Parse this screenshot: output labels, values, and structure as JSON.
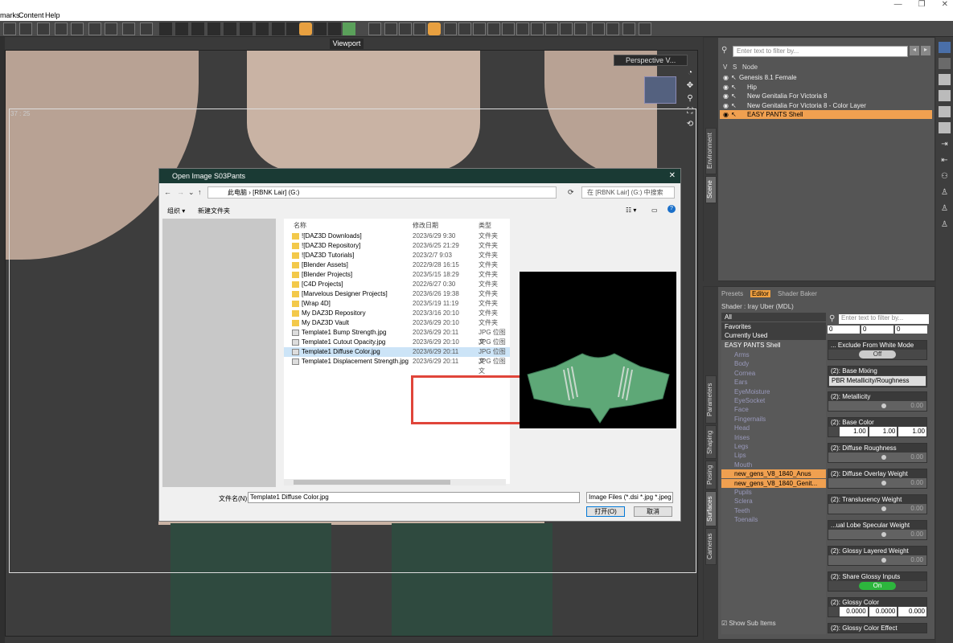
{
  "menu": [
    "marks",
    "Content",
    "Help"
  ],
  "window_controls": [
    "—",
    "❐",
    "✕"
  ],
  "viewport": {
    "tab": "Viewport",
    "camera": "Perspective V...",
    "frame_label": "37 : 25"
  },
  "dialog": {
    "title": "Open Image S03Pants",
    "address": "此电脑  ›  [RBNK Lair] (G:)",
    "search_placeholder": "在 [RBNK Lair] (G:) 中搜索",
    "organize": "组织 ▾",
    "new_folder": "新建文件夹",
    "columns": {
      "name": "名称",
      "date": "修改日期",
      "type": "类型"
    },
    "files": [
      {
        "name": "![DAZ3D Downloads]",
        "date": "2023/6/29 9:30",
        "type": "文件夹",
        "kind": "folder"
      },
      {
        "name": "![DAZ3D Repository]",
        "date": "2023/6/25 21:29",
        "type": "文件夹",
        "kind": "folder"
      },
      {
        "name": "![DAZ3D Tutorials]",
        "date": "2023/2/7 9:03",
        "type": "文件夹",
        "kind": "folder"
      },
      {
        "name": "[Blender Assets]",
        "date": "2022/9/28 16:15",
        "type": "文件夹",
        "kind": "folder"
      },
      {
        "name": "[Blender Projects]",
        "date": "2023/5/15 18:29",
        "type": "文件夹",
        "kind": "folder"
      },
      {
        "name": "[C4D Projects]",
        "date": "2022/6/27 0:30",
        "type": "文件夹",
        "kind": "folder"
      },
      {
        "name": "[Marvelous Designer Projects]",
        "date": "2023/6/26 19:38",
        "type": "文件夹",
        "kind": "folder"
      },
      {
        "name": "[Wrap 4D]",
        "date": "2023/5/19 11:19",
        "type": "文件夹",
        "kind": "folder"
      },
      {
        "name": "My DAZ3D Repository",
        "date": "2023/3/16 20:10",
        "type": "文件夹",
        "kind": "folder"
      },
      {
        "name": "My DAZ3D Vault",
        "date": "2023/6/29 20:10",
        "type": "文件夹",
        "kind": "folder"
      },
      {
        "name": "Template1 Bump Strength.jpg",
        "date": "2023/6/29 20:11",
        "type": "JPG 位图文",
        "kind": "jpg"
      },
      {
        "name": "Template1 Cutout Opacity.jpg",
        "date": "2023/6/29 20:10",
        "type": "JPG 位图文",
        "kind": "jpg"
      },
      {
        "name": "Template1 Diffuse Color.jpg",
        "date": "2023/6/29 20:11",
        "type": "JPG 位图文",
        "kind": "jpg",
        "selected": true
      },
      {
        "name": "Template1 Displacement Strength.jpg",
        "date": "2023/6/29 20:11",
        "type": "JPG 位图文",
        "kind": "jpg"
      }
    ],
    "filename_label": "文件名(N):",
    "filename": "Template1 Diffuse Color.jpg",
    "filetype": "Image Files (*.dsi *.jpg *.jpeg",
    "open_btn": "打开(O)",
    "cancel_btn": "取消"
  },
  "scene": {
    "tabs": [
      "Environment",
      "Scene"
    ],
    "filter_placeholder": "Enter text to filter by...",
    "header": {
      "v": "V",
      "s": "S",
      "node": "Node"
    },
    "nodes": [
      {
        "label": "Genesis 8.1 Female",
        "indent": 0
      },
      {
        "label": "Hip",
        "indent": 1
      },
      {
        "label": "New Genitalia For Victoria 8",
        "indent": 1
      },
      {
        "label": "New Genitalia For Victoria 8 - Color Layer",
        "indent": 1
      },
      {
        "label": "EASY PANTS Shell",
        "indent": 1,
        "selected": true
      }
    ]
  },
  "surfaces": {
    "tabs": [
      "Presets",
      "Editor",
      "Shader Baker"
    ],
    "shader": "Shader : Iray Uber (MDL)",
    "side_tabs": [
      "Parameters",
      "Shaping",
      "Posing",
      "Surfaces",
      "Cameras"
    ],
    "categories": [
      "All",
      "Favorites",
      "Currently Used"
    ],
    "root": "EASY PANTS Shell",
    "items": [
      "Arms",
      "Body",
      "Cornea",
      "Ears",
      "EyeMoisture",
      "EyeSocket",
      "Face",
      "Fingernails",
      "Head",
      "Irises",
      "Legs",
      "Lips",
      "Mouth",
      "new_gens_V8_1840_Anus",
      "new_gens_V8_1840_Genit...",
      "Pupils",
      "Sclera",
      "Teeth",
      "Toenails"
    ],
    "show_sub_items": "Show Sub Items",
    "prop_filter": "Enter text to filter by...",
    "top_values": [
      "0",
      "0",
      "0"
    ],
    "props": {
      "exclude": "... Exclude From White Mode",
      "exclude_val": "Off",
      "base_mixing": "(2): Base Mixing",
      "base_mixing_val": "PBR Metallicity/Roughness",
      "metallicity": "(2): Metallicity",
      "metallicity_val": "0.00",
      "base_color": "(2): Base Color",
      "base_color_vals": [
        "1.00",
        "1.00",
        "1.00"
      ],
      "diffuse_rough": "(2): Diffuse Roughness",
      "diffuse_rough_val": "0.00",
      "diffuse_overlay": "(2): Diffuse Overlay Weight",
      "diffuse_overlay_val": "0.00",
      "translucency": "(2): Translucency Weight",
      "translucency_val": "0.00",
      "dual_lobe": "...ual Lobe Specular Weight",
      "dual_lobe_val": "0.00",
      "glossy_layered": "(2): Glossy Layered Weight",
      "glossy_layered_val": "0.00",
      "share_glossy": "(2): Share Glossy Inputs",
      "share_glossy_val": "On",
      "glossy_color": "(2): Glossy Color",
      "glossy_color_vals": [
        "0.0000",
        "0.0000",
        "0.000"
      ],
      "glossy_effect": "(2): Glossy Color Effect"
    }
  }
}
